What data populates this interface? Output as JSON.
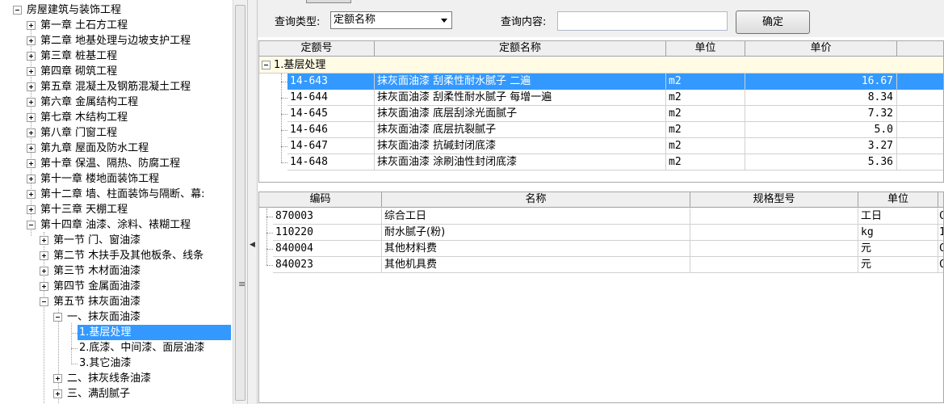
{
  "tree": {
    "root": "房屋建筑与装饰工程",
    "chapters": [
      "第一章 土石方工程",
      "第二章 地基处理与边坡支护工程",
      "第三章 桩基工程",
      "第四章 砌筑工程",
      "第五章 混凝土及钢筋混凝土工程",
      "第六章 金属结构工程",
      "第七章 木结构工程",
      "第八章 门窗工程",
      "第九章 屋面及防水工程",
      "第十章 保温、隔热、防腐工程",
      "第十一章 楼地面装饰工程",
      "第十二章 墙、柱面装饰与隔断、幕:",
      "第十三章 天棚工程",
      "第十四章 油漆、涂料、裱糊工程"
    ],
    "sections": [
      "第一节 门、窗油漆",
      "第二节 木扶手及其他板条、线条",
      "第三节 木材面油漆",
      "第四节 金属面油漆",
      "第五节 抹灰面油漆"
    ],
    "subsections": [
      "一、抹灰面油漆",
      "二、抹灰线条油漆",
      "三、满刮腻子"
    ],
    "items": [
      "1.基层处理",
      "2.底漆、中间漆、面层油漆",
      "3.其它油漆"
    ],
    "selected": "1.基层处理"
  },
  "query": {
    "type_label": "查询类型:",
    "type_value": "定额名称",
    "content_label": "查询内容:",
    "content_value": "",
    "confirm_label": "确定"
  },
  "quota_table": {
    "headers": [
      "定额号",
      "定额名称",
      "单位",
      "单价"
    ],
    "group": "1.基层处理",
    "rows": [
      {
        "code": "14-643",
        "name": "抹灰面油漆 刮柔性耐水腻子 二遍",
        "unit": "m2",
        "price": "16.67"
      },
      {
        "code": "14-644",
        "name": "抹灰面油漆 刮柔性耐水腻子 每增一遍",
        "unit": "m2",
        "price": "8.34"
      },
      {
        "code": "14-645",
        "name": "抹灰面油漆 底层刮涂光面腻子",
        "unit": "m2",
        "price": "7.32"
      },
      {
        "code": "14-646",
        "name": "抹灰面油漆 底层抗裂腻子",
        "unit": "m2",
        "price": "5.0"
      },
      {
        "code": "14-647",
        "name": "抹灰面油漆 抗碱封闭底漆",
        "unit": "m2",
        "price": "3.27"
      },
      {
        "code": "14-648",
        "name": "抹灰面油漆 涂刷油性封闭底漆",
        "unit": "m2",
        "price": "5.36"
      }
    ],
    "selected_row": 0
  },
  "material_table": {
    "headers": [
      "编码",
      "名称",
      "规格型号",
      "单位"
    ],
    "rows": [
      {
        "code": "870003",
        "name": "综合工日",
        "spec": "",
        "unit": "工日",
        "extra": "C"
      },
      {
        "code": "110220",
        "name": "耐水腻子(粉)",
        "spec": "",
        "unit": "kg",
        "extra": "1"
      },
      {
        "code": "840004",
        "name": "其他材料费",
        "spec": "",
        "unit": "元",
        "extra": "C"
      },
      {
        "code": "840023",
        "name": "其他机具费",
        "spec": "",
        "unit": "元",
        "extra": "C"
      }
    ]
  },
  "colors": {
    "selection": "#3399ff",
    "group_row_bg": "#fffbe5",
    "panel_bg": "#f0f0f0"
  }
}
